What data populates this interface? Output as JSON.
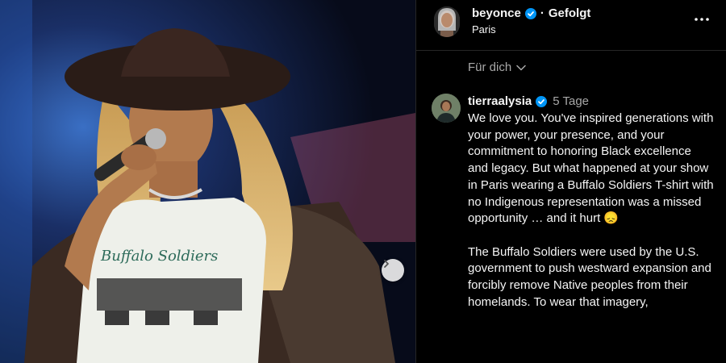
{
  "post": {
    "username": "beyonce",
    "follow_status": "Gefolgt",
    "location": "Paris"
  },
  "feed_filter": {
    "label": "Für dich"
  },
  "comment": {
    "username": "tierraalysia",
    "time": "5 Tage",
    "paragraph1": "We love you. You've inspired generations with your power, your presence, and your commitment to honoring Black excellence and legacy. But what happened at your show in Paris wearing a Buffalo Soldiers T-shirt with no Indigenous representation was a missed opportunity … and it hurt 😞",
    "paragraph2": "The Buffalo Soldiers were used by the U.S. government to push westward expansion and forcibly remove Native peoples from their homelands. To wear that imagery,"
  },
  "photo": {
    "shirt_text": "Buffalo Soldiers"
  },
  "colors": {
    "background": "#000000",
    "text": "#f5f5f5",
    "muted": "#a8a8a8",
    "verified_blue": "#0095f6",
    "divider": "#262626"
  },
  "icons": {
    "verified": "verified-badge-icon",
    "more": "more-options-icon",
    "chevron": "chevron-down-icon",
    "next": "chevron-right-icon"
  }
}
